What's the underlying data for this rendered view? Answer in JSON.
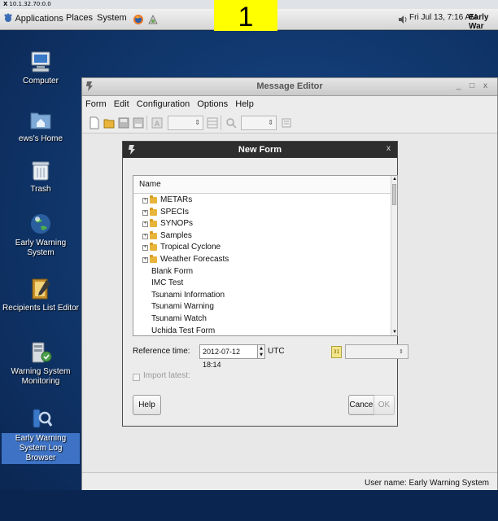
{
  "vnc_title": "10.1.32.70:0.0",
  "top_panel": {
    "menus": [
      "Applications",
      "Places",
      "System"
    ],
    "clock": "Fri Jul 13,  7:16 AM",
    "session_label": "Early War"
  },
  "badge": "1",
  "desktop_icons": [
    {
      "label": "Computer"
    },
    {
      "label": "ews's Home"
    },
    {
      "label": "Trash"
    },
    {
      "label": "Early Warning System"
    },
    {
      "label": "Recipients List Editor"
    },
    {
      "label": "Warning System Monitoring"
    },
    {
      "label": "Early Warning System Log Browser",
      "selected": true
    }
  ],
  "editor": {
    "title": "Message Editor",
    "window_controls": "_ □ x",
    "menus": [
      "Form",
      "Edit",
      "Configuration",
      "Options",
      "Help"
    ],
    "status_user": "User name: Early Warning System"
  },
  "dialog": {
    "title": "New Form",
    "close": "x",
    "tree_header": "Name",
    "folders": [
      "METARs",
      "SPECIs",
      "SYNOPs",
      "Samples",
      "Tropical Cyclone",
      "Weather Forecasts"
    ],
    "forms": [
      "Blank Form",
      "IMC Test",
      "Tsunami Information",
      "Tsunami Warning",
      "Tsunami Watch",
      "Uchida Test Form"
    ],
    "reference_time_label": "Reference time:",
    "reference_time_value": "2012-07-12 18:14",
    "reference_time_unit": "UTC",
    "calendar_glyph": "31",
    "import_latest_label": "Import latest:",
    "help_label": "Help",
    "cancel_label": "Cancel",
    "ok_label": "OK"
  }
}
